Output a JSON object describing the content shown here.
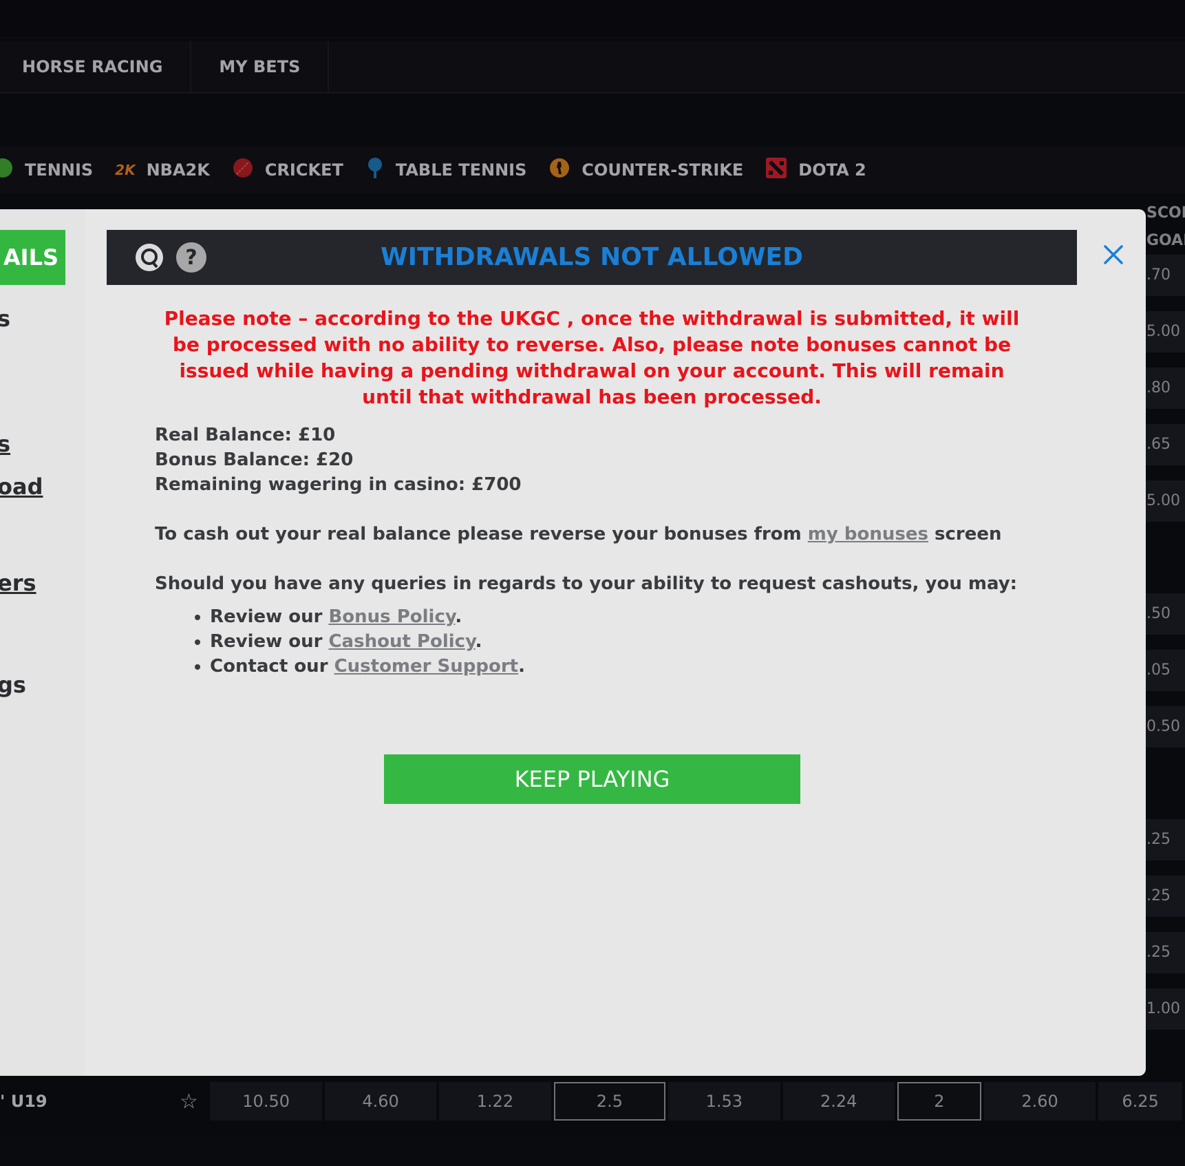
{
  "nav": {
    "items": [
      "HORSE RACING",
      "MY BETS"
    ]
  },
  "sports": [
    {
      "label": "TENNIS",
      "icon": "tennis-ball-icon",
      "color": "#3c9a2f"
    },
    {
      "label": "NBA2K",
      "icon": "nba2k-logo-icon",
      "color": "#d8771f"
    },
    {
      "label": "CRICKET",
      "icon": "cricket-ball-icon",
      "color": "#a71e22"
    },
    {
      "label": "TABLE TENNIS",
      "icon": "table-tennis-paddle-icon",
      "color": "#1b6fa8"
    },
    {
      "label": "COUNTER-STRIKE",
      "icon": "counter-strike-icon",
      "color": "#c8791d"
    },
    {
      "label": "DOTA 2",
      "icon": "dota2-logo-icon",
      "color": "#c41e2a"
    }
  ],
  "background_right": {
    "headers": [
      "SCOR",
      "GOAL"
    ],
    "odds": [
      ".70",
      "5.00",
      ".80",
      ".65",
      "5.00",
      "",
      ".50",
      ".05",
      "0.50",
      "",
      ".25",
      ".25",
      ".25",
      "1.00"
    ]
  },
  "bottom_row": {
    "team": "' U19",
    "odds": [
      "10.50",
      "4.60",
      "1.22",
      "2.5",
      "1.53",
      "2.24",
      "2",
      "2.60",
      "6.25"
    ]
  },
  "left_fragments": [
    "AILS",
    "s",
    "s",
    "oad",
    "ers",
    "gs"
  ],
  "dialog": {
    "title": "WITHDRAWALS NOT ALLOWED",
    "notice": "Please note – according to the UKGC , once the withdrawal is submitted, it will be processed with no ability to reverse. Also, please note bonuses cannot be issued while having a pending withdrawal on your account. This will remain until that withdrawal has been processed.",
    "real_balance": "Real Balance: £10",
    "bonus_balance": "Bonus Balance: £20",
    "remaining_wagering": "Remaining wagering in casino: £700",
    "cashout_prefix": "To cash out your real balance please reverse your bonuses from ",
    "cashout_link": "my bonuses",
    "cashout_suffix": " screen",
    "queries": "Should you have any queries in regards to your ability to request cashouts, you may:",
    "bullets": [
      {
        "prefix": "Review our ",
        "link": "Bonus Policy",
        "suffix": "."
      },
      {
        "prefix": "Review our ",
        "link": "Cashout Policy",
        "suffix": "."
      },
      {
        "prefix": "Contact our ",
        "link": "Customer Support",
        "suffix": "."
      }
    ],
    "keep_playing": "KEEP PLAYING",
    "help_glyph": "?"
  },
  "colors": {
    "title_blue": "#1a7fd6",
    "notice_red": "#e8141b",
    "button_green": "#34b843"
  }
}
